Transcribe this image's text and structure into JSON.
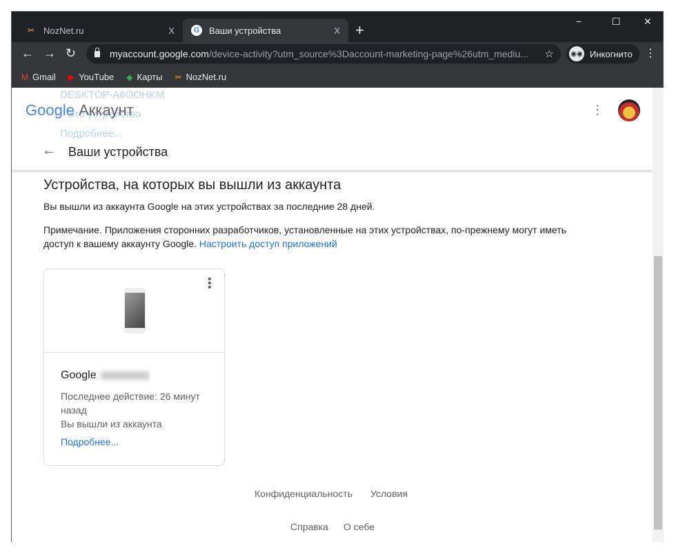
{
  "tabs": [
    {
      "title": "NozNet.ru",
      "close": "X"
    },
    {
      "title": "Ваши устройства",
      "close": "X"
    }
  ],
  "new_tab": "+",
  "window_controls": {
    "min": "−",
    "max": "☐",
    "close": "✕"
  },
  "address": {
    "host": "myaccount.google.com",
    "path": "/device-activity?utm_source%3Daccount-marketing-page%26utm_mediu..."
  },
  "incognito_label": "Инкогнито",
  "bookmarks": [
    "Gmail",
    "YouTube",
    "Карты",
    "NozNet.ru"
  ],
  "ghost_text": [
    "DESKTOP-A8OOHKM",
    "Это устройство",
    "Подробнее..."
  ],
  "header": {
    "logo_google": "Google",
    "logo_product": "Аккаунт",
    "page_title": "Ваши устройства"
  },
  "main": {
    "heading": "Устройства, на которых вы вышли из аккаунта",
    "intro": "Вы вышли из аккаунта Google на этих устройствах за последние 28 дней.",
    "note": "Примечание. Приложения сторонних разработчиков, установленные на этих устройствах, по-прежнему могут иметь доступ к вашему аккаунту Google.",
    "note_link": "Настроить доступ приложений"
  },
  "device_card": {
    "name": "Google",
    "last_activity": "Последнее действие: 26 минут назад",
    "status": "Вы вышли из аккаунта",
    "more": "Подробнее..."
  },
  "footer": {
    "privacy": "Конфиденциальность",
    "terms": "Условия",
    "help": "Справка",
    "about": "О себе"
  }
}
